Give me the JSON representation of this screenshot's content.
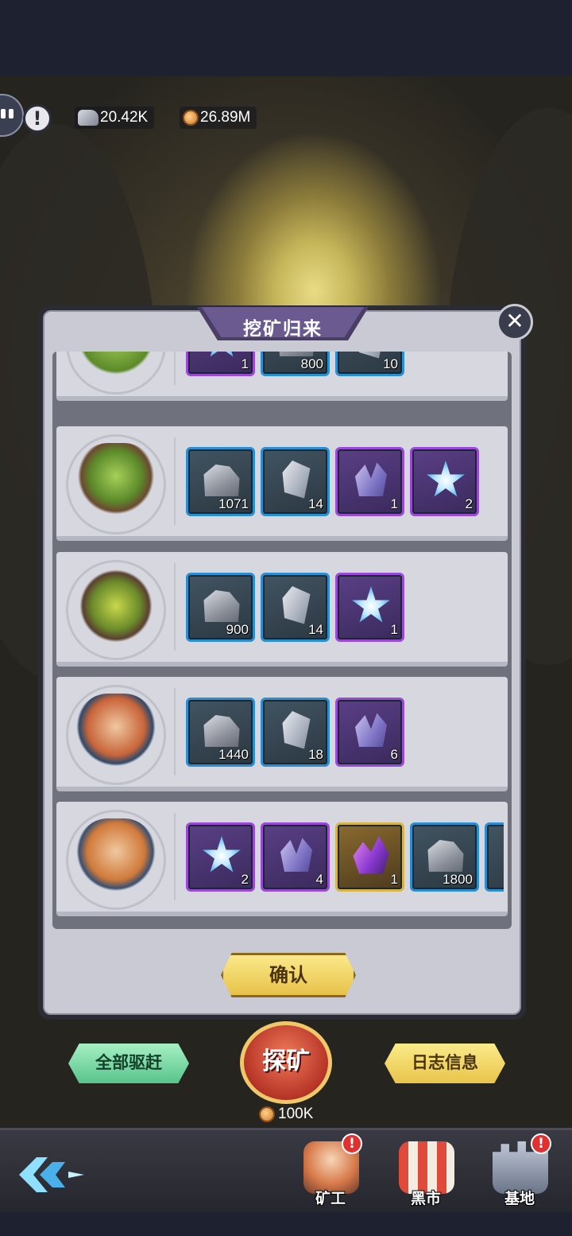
{
  "resources": {
    "ore": "20.42K",
    "gold": "26.89M"
  },
  "dialog": {
    "title": "挖矿归来",
    "close_symbol": "✕",
    "confirm_label": "确认"
  },
  "rows": [
    {
      "miner": "goblin-miner-partial",
      "items": [
        {
          "type": "star",
          "rarity": "purple",
          "qty": "1"
        },
        {
          "type": "rock",
          "rarity": "blue",
          "qty": "800"
        },
        {
          "type": "shard",
          "rarity": "blue",
          "qty": "10"
        }
      ]
    },
    {
      "miner": "goblin-miner-helmet",
      "items": [
        {
          "type": "rock",
          "rarity": "blue",
          "qty": "1071"
        },
        {
          "type": "shard",
          "rarity": "blue",
          "qty": "14"
        },
        {
          "type": "crystal",
          "rarity": "purple",
          "qty": "1"
        },
        {
          "type": "star",
          "rarity": "purple",
          "qty": "2"
        }
      ]
    },
    {
      "miner": "goblin-miner-goggles",
      "items": [
        {
          "type": "rock",
          "rarity": "blue",
          "qty": "900"
        },
        {
          "type": "shard",
          "rarity": "blue",
          "qty": "14"
        },
        {
          "type": "star",
          "rarity": "purple",
          "qty": "1"
        }
      ]
    },
    {
      "miner": "dwarf-miner-shovel",
      "items": [
        {
          "type": "rock",
          "rarity": "blue",
          "qty": "1440"
        },
        {
          "type": "shard",
          "rarity": "blue",
          "qty": "18"
        },
        {
          "type": "crystal",
          "rarity": "purple",
          "qty": "6"
        }
      ]
    },
    {
      "miner": "dwarf-miner-bearded",
      "items": [
        {
          "type": "star",
          "rarity": "purple",
          "qty": "2"
        },
        {
          "type": "crystal",
          "rarity": "purple",
          "qty": "4"
        },
        {
          "type": "amethyst",
          "rarity": "gold",
          "qty": "1"
        },
        {
          "type": "rock",
          "rarity": "blue",
          "qty": "1800"
        },
        {
          "type": "shard",
          "rarity": "blue",
          "qty": ""
        }
      ]
    }
  ],
  "actions": {
    "drive_all": "全部驱赶",
    "mine": "探矿",
    "mine_cost": "100K",
    "log": "日志信息"
  },
  "nav": {
    "miners": "矿工",
    "market": "黑市",
    "base": "基地",
    "alert_symbol": "!"
  },
  "colors": {
    "rarity_blue": "#2a8fd0",
    "rarity_purple": "#9a48d8",
    "rarity_gold": "#d8b448"
  }
}
